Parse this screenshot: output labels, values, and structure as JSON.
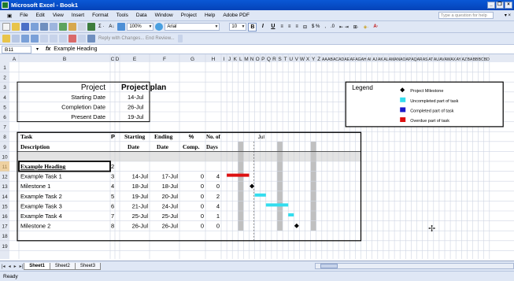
{
  "window": {
    "title": "Microsoft Excel - Book1"
  },
  "menu": {
    "items": [
      "File",
      "Edit",
      "View",
      "Insert",
      "Format",
      "Tools",
      "Data",
      "Window",
      "Project",
      "Help",
      "Adobe PDF"
    ],
    "help_placeholder": "Type a question for help"
  },
  "toolbar": {
    "zoom": "100%",
    "font": "Arial",
    "size": "10",
    "reviewing": "Reply with Changes... End Review..."
  },
  "formula": {
    "cell_ref": "B11",
    "fx": "fx",
    "content": "Example Heading"
  },
  "columns": [
    "A",
    "B",
    "C",
    "D",
    "E",
    "F",
    "G",
    "H",
    "I",
    "J",
    "K",
    "L",
    "M",
    "N",
    "O",
    "P",
    "Q",
    "R",
    "S",
    "T",
    "U",
    "V",
    "W",
    "X",
    "Y",
    "Z",
    "AA",
    "AB",
    "AC",
    "AD",
    "AE",
    "AF",
    "AG",
    "AH",
    "AI",
    "AJ",
    "AK",
    "AL",
    "AM",
    "AN",
    "AO",
    "AP",
    "AQ",
    "AR",
    "AS",
    "AT",
    "AU",
    "AV",
    "AW",
    "AX",
    "AY",
    "AZ",
    "BA",
    "BB",
    "BC",
    "BD"
  ],
  "rows": [
    "1",
    "2",
    "3",
    "4",
    "5",
    "6",
    "7",
    "8",
    "9",
    "10",
    "11",
    "12",
    "13",
    "14",
    "15",
    "16",
    "17",
    "18",
    "19"
  ],
  "project": {
    "label": "Project",
    "title": "Project plan",
    "starting_label": "Starting Date",
    "starting": "14-Jul",
    "completion_label": "Completion Date",
    "completion": "26-Jul",
    "present_label": "Present Date",
    "present": "19-Jul"
  },
  "table": {
    "h_task": "Task",
    "h_desc": "Description",
    "h_p": "P",
    "h_start1": "Starting",
    "h_start2": "Date",
    "h_end1": "Ending",
    "h_end2": "Date",
    "h_pct1": "%",
    "h_pct2": "Comp.",
    "h_days1": "No. of",
    "h_days2": "Days",
    "h_month": "Jul",
    "rows": [
      {
        "task": "Example Heading",
        "p": "2",
        "start": "",
        "end": "",
        "comp": "",
        "days": ""
      },
      {
        "task": "Example Task 1",
        "p": "3",
        "start": "14-Jul",
        "end": "17-Jul",
        "comp": "0",
        "days": "4"
      },
      {
        "task": "Milestone 1",
        "p": "4",
        "start": "18-Jul",
        "end": "18-Jul",
        "comp": "0",
        "days": "0"
      },
      {
        "task": "Example Task 2",
        "p": "5",
        "start": "19-Jul",
        "end": "20-Jul",
        "comp": "0",
        "days": "2"
      },
      {
        "task": "Example Task 3",
        "p": "6",
        "start": "21-Jul",
        "end": "24-Jul",
        "comp": "0",
        "days": "4"
      },
      {
        "task": "Example Task 4",
        "p": "7",
        "start": "25-Jul",
        "end": "25-Jul",
        "comp": "0",
        "days": "1"
      },
      {
        "task": "Milestone 2",
        "p": "8",
        "start": "26-Jul",
        "end": "26-Jul",
        "comp": "0",
        "days": "0"
      }
    ]
  },
  "legend": {
    "title": "Legend",
    "items": [
      {
        "label": "Project Milestone",
        "color": "#000000",
        "shape": "diamond"
      },
      {
        "label": "Uncompleted part of task",
        "color": "#33ddee",
        "shape": "box"
      },
      {
        "label": "Completed part of task",
        "color": "#1a1acc",
        "shape": "box"
      },
      {
        "label": "Overdue part of task",
        "color": "#dd1111",
        "shape": "box"
      }
    ]
  },
  "sheets": [
    "Sheet1",
    "Sheet2",
    "Sheet3"
  ],
  "status": "Ready",
  "colors": {
    "title_bar": "#0a58d6",
    "chrome": "#dfe7f5",
    "grid_line": "#cfd6e3",
    "shade": "#c0c0c0",
    "overdue": "#dd1111",
    "uncompleted": "#33ddee"
  }
}
